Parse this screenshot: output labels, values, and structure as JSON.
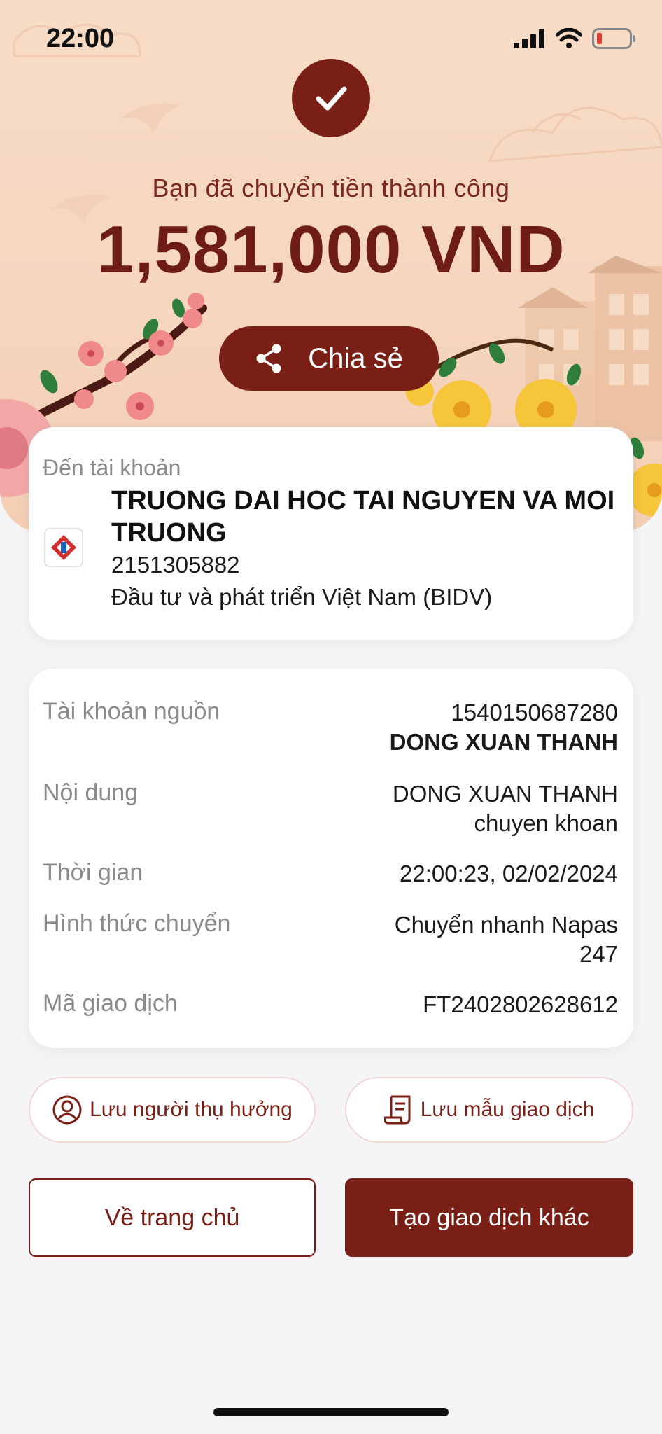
{
  "status_bar": {
    "time": "22:00"
  },
  "success": {
    "message": "Bạn đã chuyển tiền thành công",
    "amount": "1,581,000 VND",
    "share_label": "Chia sẻ"
  },
  "destination": {
    "label": "Đến tài khoản",
    "name": "TRUONG DAI HOC TAI NGUYEN VA MOI TRUONG",
    "account": "2151305882",
    "bank": "Đầu tư và phát triển Việt Nam (BIDV)"
  },
  "details": {
    "source_label": "Tài khoản nguồn",
    "source_account": "1540150687280",
    "source_name": "DONG XUAN THANH",
    "content_label": "Nội dung",
    "content_line1": "DONG XUAN THANH",
    "content_line2": "chuyen khoan",
    "time_label": "Thời gian",
    "time_value": "22:00:23, 02/02/2024",
    "method_label": "Hình thức chuyển",
    "method_line1": "Chuyển nhanh Napas",
    "method_line2": "247",
    "txn_label": "Mã giao dịch",
    "txn_value": "FT2402802628612"
  },
  "actions": {
    "save_beneficiary": "Lưu người thụ hưởng",
    "save_template": "Lưu mẫu giao dịch",
    "home": "Về trang chủ",
    "new_transaction": "Tạo giao dịch khác"
  },
  "colors": {
    "brand": "#7a1f16",
    "hero_bg": "#f6d6bf",
    "page_bg": "#f5f4f6"
  },
  "icons": [
    "check-icon",
    "share-icon",
    "user-circle-icon",
    "receipt-icon",
    "bidv-logo",
    "signal-icon",
    "wifi-icon",
    "battery-icon"
  ]
}
